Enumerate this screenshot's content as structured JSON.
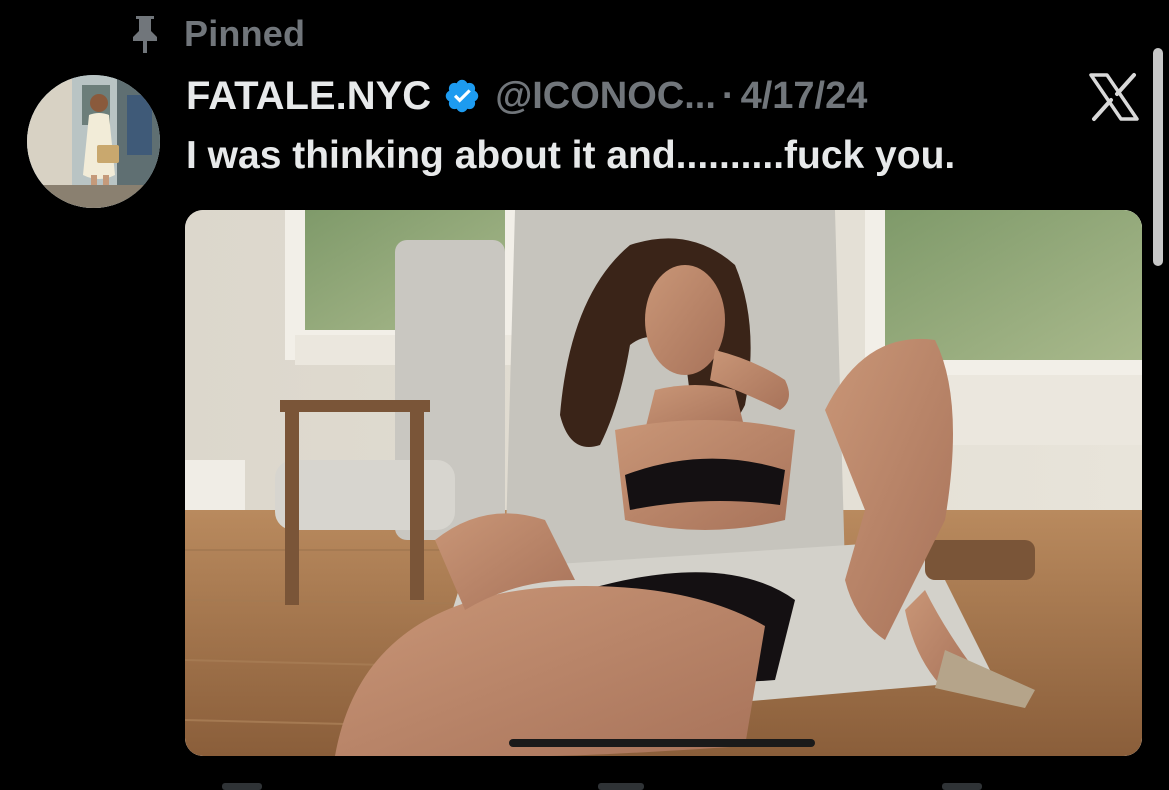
{
  "pinned": {
    "label": "Pinned",
    "icon": "pin-icon"
  },
  "tweet": {
    "display_name": "FATALE.NYC",
    "verified": true,
    "verified_color": "#1d9bf0",
    "handle": "@ICONOC...",
    "separator": "·",
    "date": "4/17/24",
    "text": "I was thinking about it and..........fuck you.",
    "media_alt": "photo of woman in lingerie reclining in chair"
  },
  "brand": {
    "logo": "x-logo-icon"
  },
  "colors": {
    "background": "#000000",
    "primary_text": "#e7e9ea",
    "secondary_text": "#71767b"
  }
}
